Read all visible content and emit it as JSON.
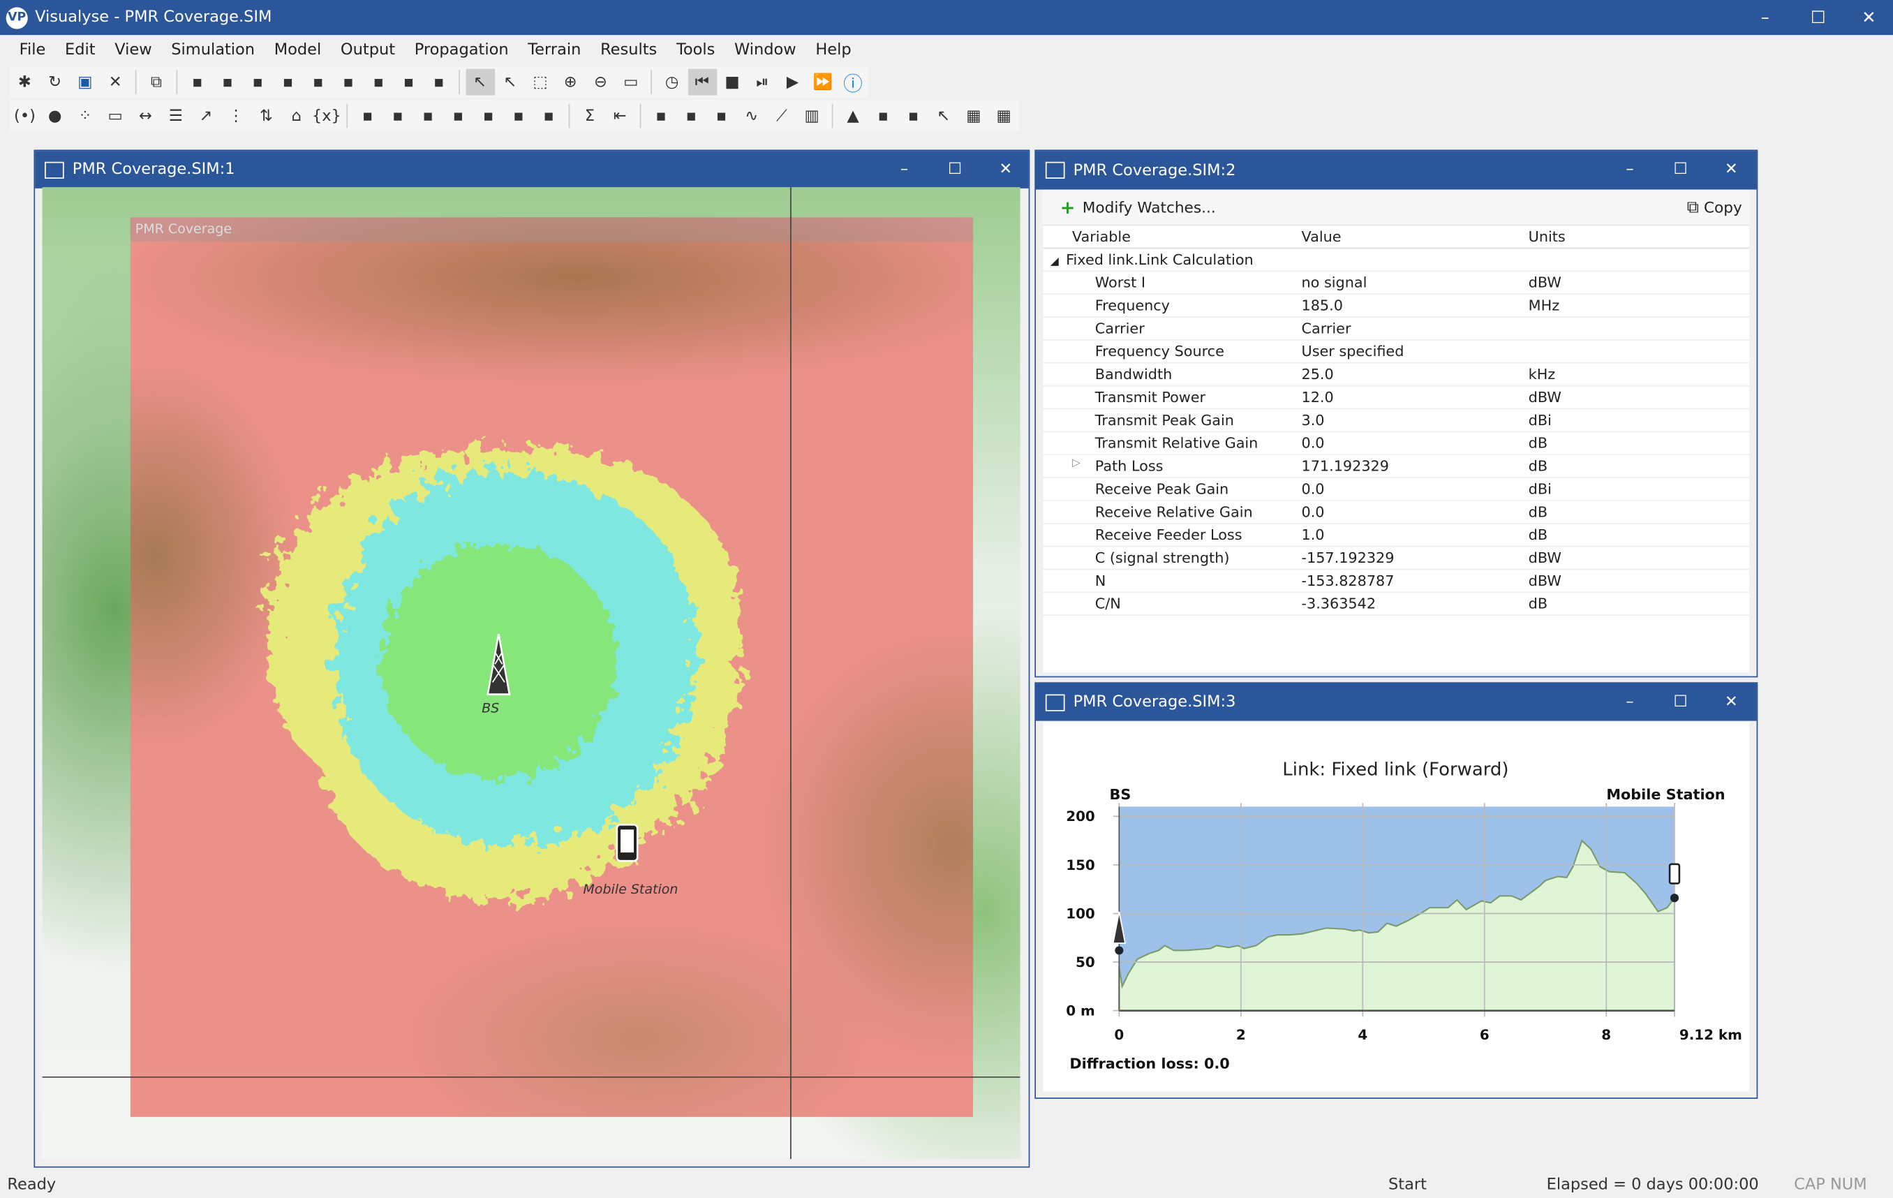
{
  "app": {
    "title": "Visualyse - PMR Coverage.SIM",
    "logo": "VP",
    "controls": [
      "minimize",
      "maximize",
      "close"
    ]
  },
  "menu": [
    "File",
    "Edit",
    "View",
    "Simulation",
    "Model",
    "Output",
    "Propagation",
    "Terrain",
    "Results",
    "Tools",
    "Window",
    "Help"
  ],
  "toolbar1": [
    "new-icon",
    "open-icon",
    "save-icon",
    "close-file-icon",
    "|",
    "copy-icon",
    "|",
    "propagation-window-icon",
    "model-window-icon",
    "globe-window-icon",
    "link-tree-icon",
    "antenna-window-icon",
    "terrain-window-icon",
    "table-window-icon",
    "chart-window-icon",
    "plot-window-icon",
    "|",
    "select-pointer-icon",
    "select-station-icon",
    "select-area-icon",
    "zoom-in-icon",
    "zoom-out-icon",
    "zoom-100-icon",
    "|",
    "clock-icon",
    "rewind-icon",
    "stop-icon",
    "step-icon",
    "play-icon",
    "fast-forward-icon",
    "info-icon"
  ],
  "toolbar2": [
    "station-icon",
    "point-icon",
    "group-icon",
    "beam-icon",
    "link-icon",
    "multi-link-icon",
    "carrier-icon",
    "network-icon",
    "swap-icon",
    "terrain-link-icon",
    "variable-icon",
    "|",
    "fixed-station-icon",
    "mobile-station-icon",
    "mobile-path-icon",
    "terminal-icon",
    "ground-station-icon",
    "interferer-icon",
    "victim-icon",
    "|",
    "sum-icon",
    "define-icon",
    "|",
    "watch-icon",
    "coverage-icon",
    "add-coverage-icon",
    "graph-icon",
    "ccdf-icon",
    "histogram-icon",
    "|",
    "terrain-profile-icon",
    "add-terrain-icon",
    "add-path-icon",
    "route-icon",
    "add-grid-icon",
    "grid-icon"
  ],
  "win1": {
    "title": "PMR Coverage.SIM:1",
    "overlay_title": "PMR Coverage",
    "bs_label": "BS",
    "ms_label": "Mobile Station"
  },
  "win2": {
    "title": "PMR Coverage.SIM:2",
    "modify_label": "Modify Watches...",
    "copy_label": "Copy",
    "headers": [
      "Variable",
      "Value",
      "Units"
    ],
    "group": "Fixed link.Link Calculation",
    "rows": [
      [
        "Worst I",
        "no signal",
        "dBW"
      ],
      [
        "Frequency",
        "185.0",
        "MHz"
      ],
      [
        "Carrier",
        "Carrier",
        ""
      ],
      [
        "Frequency Source",
        "User specified",
        ""
      ],
      [
        "Bandwidth",
        "25.0",
        "kHz"
      ],
      [
        "Transmit Power",
        "12.0",
        "dBW"
      ],
      [
        "Transmit Peak Gain",
        "3.0",
        "dBi"
      ],
      [
        "Transmit Relative Gain",
        "0.0",
        "dB"
      ],
      [
        "Path Loss",
        "171.192329",
        "dB"
      ],
      [
        "Receive Peak Gain",
        "0.0",
        "dBi"
      ],
      [
        "Receive Relative Gain",
        "0.0",
        "dB"
      ],
      [
        "Receive Feeder Loss",
        "1.0",
        "dB"
      ],
      [
        "C (signal strength)",
        "-157.192329",
        "dBW"
      ],
      [
        "N",
        "-153.828787",
        "dBW"
      ],
      [
        "C/N",
        "-3.363542",
        "dB"
      ]
    ]
  },
  "win3": {
    "title": "PMR Coverage.SIM:3",
    "footer": "Diffraction loss: 0.0"
  },
  "chart_data": {
    "type": "area",
    "title": "Link: Fixed link (Forward)",
    "left_label": "BS",
    "right_label": "Mobile Station",
    "xticks": [
      "0",
      "2",
      "4",
      "6",
      "8",
      "9.12 km"
    ],
    "xtick_values": [
      0,
      2,
      4,
      6,
      8,
      9.12
    ],
    "yticks": [
      "0 m",
      "50",
      "100",
      "150",
      "200"
    ],
    "ytick_values": [
      0,
      50,
      100,
      150,
      200
    ],
    "xlim": [
      0,
      9.12
    ],
    "ylim": [
      0,
      210
    ],
    "grid": true,
    "terrain": [
      [
        0,
        45
      ],
      [
        0.05,
        25
      ],
      [
        0.15,
        38
      ],
      [
        0.3,
        53
      ],
      [
        0.5,
        59
      ],
      [
        0.65,
        62
      ],
      [
        0.75,
        67
      ],
      [
        0.9,
        62
      ],
      [
        1.1,
        62
      ],
      [
        1.3,
        63
      ],
      [
        1.5,
        64
      ],
      [
        1.6,
        67
      ],
      [
        1.8,
        65
      ],
      [
        1.95,
        67
      ],
      [
        2.05,
        64
      ],
      [
        2.25,
        67
      ],
      [
        2.45,
        76
      ],
      [
        2.6,
        78
      ],
      [
        2.8,
        78
      ],
      [
        3.0,
        79
      ],
      [
        3.2,
        82
      ],
      [
        3.4,
        85
      ],
      [
        3.7,
        84
      ],
      [
        3.85,
        82
      ],
      [
        3.95,
        83
      ],
      [
        4.1,
        80
      ],
      [
        4.25,
        81
      ],
      [
        4.4,
        90
      ],
      [
        4.55,
        87
      ],
      [
        4.75,
        93
      ],
      [
        4.95,
        100
      ],
      [
        5.1,
        106
      ],
      [
        5.4,
        106
      ],
      [
        5.55,
        114
      ],
      [
        5.7,
        104
      ],
      [
        5.95,
        113
      ],
      [
        6.1,
        111
      ],
      [
        6.25,
        118
      ],
      [
        6.45,
        118
      ],
      [
        6.6,
        114
      ],
      [
        6.9,
        128
      ],
      [
        7.0,
        134
      ],
      [
        7.2,
        138
      ],
      [
        7.35,
        137
      ],
      [
        7.45,
        148
      ],
      [
        7.6,
        175
      ],
      [
        7.75,
        166
      ],
      [
        7.9,
        148
      ],
      [
        8.05,
        143
      ],
      [
        8.3,
        142
      ],
      [
        8.5,
        131
      ],
      [
        8.65,
        120
      ],
      [
        8.85,
        102
      ],
      [
        9.0,
        106
      ],
      [
        9.12,
        116
      ]
    ],
    "tx_height": 62,
    "rx_height": 116,
    "sky_color": "#9ec1e9",
    "terrain_color": "#e0f4d6",
    "terrain_line": "#7a9a6a"
  },
  "status": {
    "left": "Ready",
    "mid": "Start",
    "elapsed": "Elapsed = 0 days 00:00:00",
    "keys": "CAP NUM"
  },
  "colors": {
    "accent": "#2b579a",
    "coverage_strong": "#86e67a",
    "coverage_mid": "#7ee8e0",
    "coverage_weak": "#e6ea7a",
    "no_coverage": "#ec9189"
  }
}
